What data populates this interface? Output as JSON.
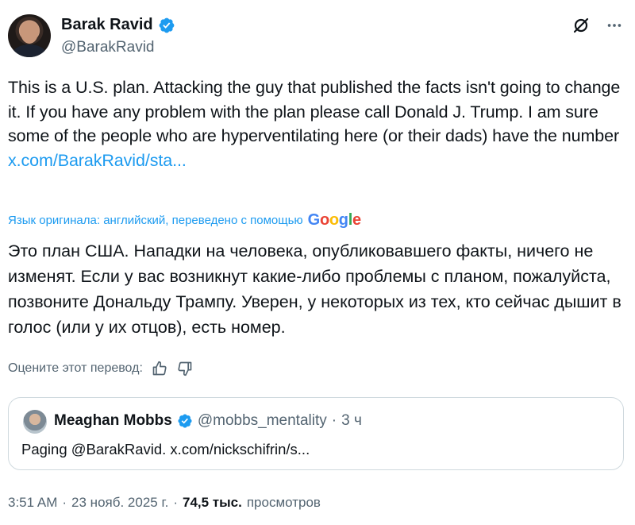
{
  "author": {
    "name": "Barak Ravid",
    "handle": "@BarakRavid"
  },
  "tweet": {
    "text": "This is a U.S. plan. Attacking the guy that published the facts isn't going to change it. If you have any problem with the plan please call Donald J. Trump. I am sure some of the people who are hyperventilating here (or their dads) have the number",
    "link": "x.com/BarakRavid/sta..."
  },
  "translation": {
    "note": "Язык оригинала: английский, переведено с помощью",
    "provider_letters": [
      "G",
      "o",
      "o",
      "g",
      "l",
      "e"
    ],
    "text": "Это план США. Нападки на человека, опубликовавшего факты, ничего не изменят. Если у вас возникнут какие-либо проблемы с планом, пожалуйста, позвоните Дональду Трампу. Уверен, у некоторых из тех, кто сейчас дышит в голос (или у их отцов), есть номер.",
    "rate_label": "Оцените этот перевод:"
  },
  "quoted": {
    "name": "Meaghan Mobbs",
    "handle": "@mobbs_mentality",
    "separator": "·",
    "time": "3 ч",
    "text": "Paging @BarakRavid. x.com/nickschifrin/s..."
  },
  "footer": {
    "time": "3:51 AM",
    "dot1": "·",
    "date": "23 нояб. 2025 г.",
    "dot2": "·",
    "views": "74,5 тыс.",
    "views_label": "просмотров"
  },
  "colors": {
    "accent": "#1d9bf0",
    "secondary_text": "#536471",
    "border": "#cfd9de"
  },
  "icons": [
    "verified-badge-icon",
    "grok-icon",
    "more-icon",
    "thumbs-up-icon",
    "thumbs-down-icon"
  ]
}
